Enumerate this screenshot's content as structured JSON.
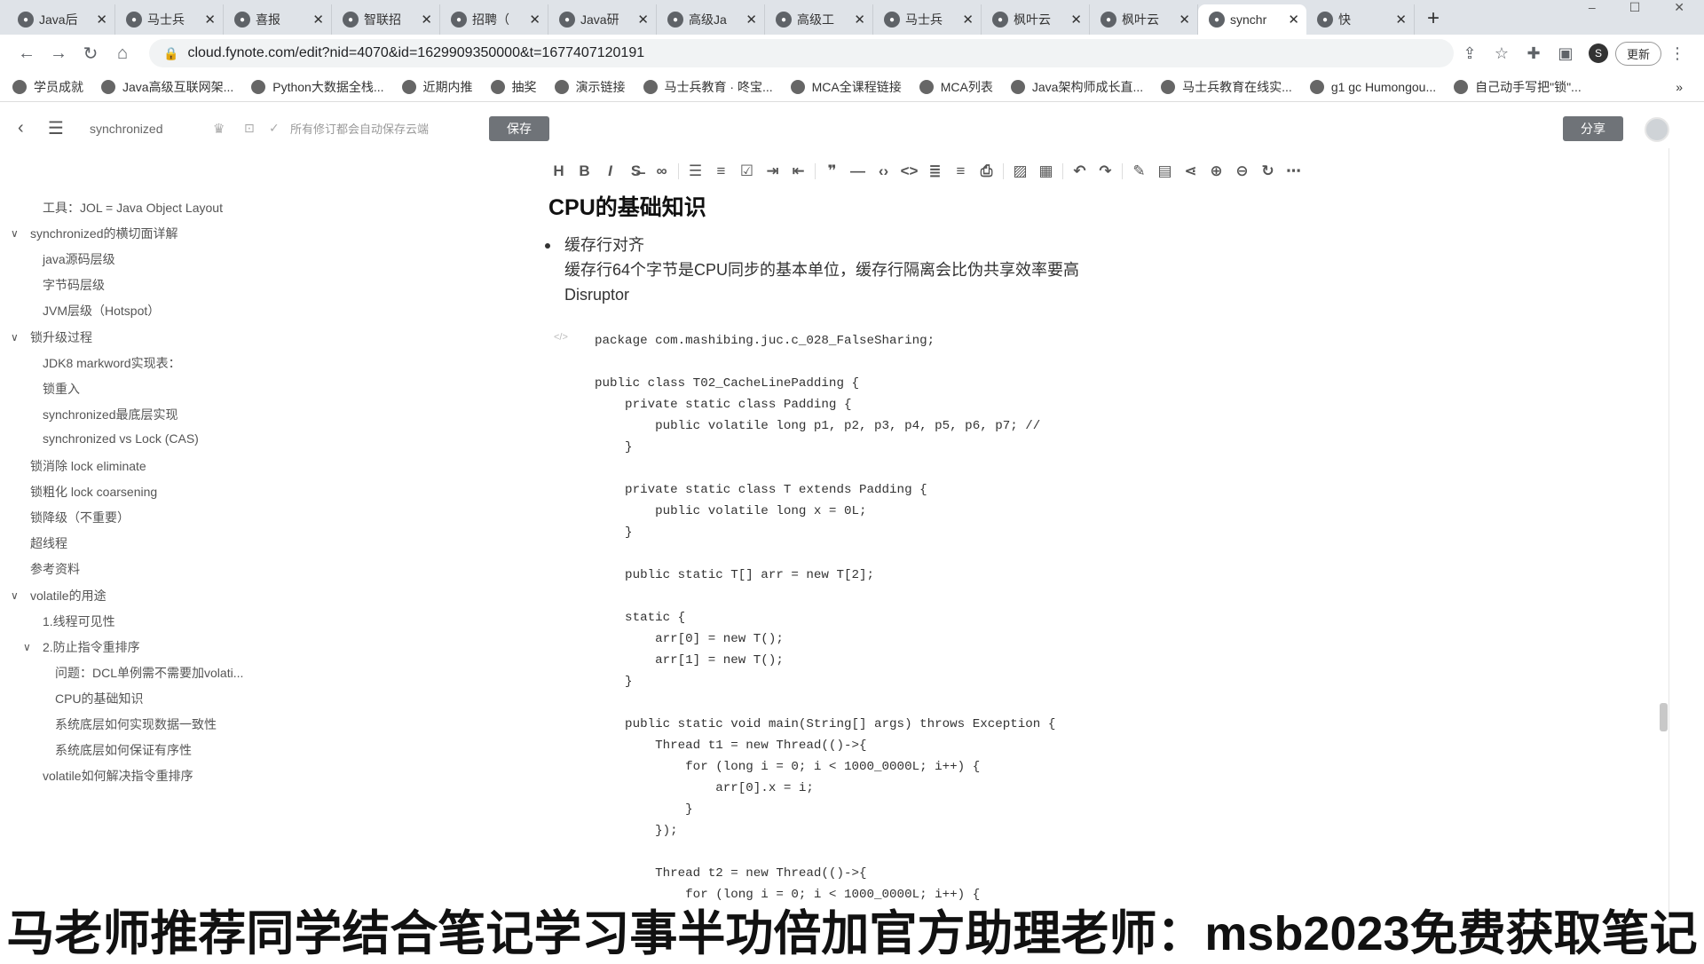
{
  "browser": {
    "tabs": [
      {
        "title": "Java后",
        "icon": "edge-icon"
      },
      {
        "title": "马士兵",
        "icon": "globe-icon"
      },
      {
        "title": "喜报",
        "icon": "flower-icon"
      },
      {
        "title": "智联招",
        "icon": "page-icon"
      },
      {
        "title": "招聘（",
        "icon": "page-icon"
      },
      {
        "title": "Java研",
        "icon": "page-icon"
      },
      {
        "title": "高级Ja",
        "icon": "page-icon"
      },
      {
        "title": "高级工",
        "icon": "page-icon"
      },
      {
        "title": "马士兵",
        "icon": "globe-icon"
      },
      {
        "title": "枫叶云",
        "icon": "leaf-icon"
      },
      {
        "title": "枫叶云",
        "icon": "leaf-icon"
      },
      {
        "title": "synchr",
        "icon": "leaf-icon",
        "active": true
      },
      {
        "title": "快",
        "icon": "globe-icon"
      }
    ],
    "new_tab": "+",
    "url": "cloud.fynote.com/edit?nid=4070&id=1629909350000&t=1677407120191",
    "profile_initial": "S",
    "update_label": "更新",
    "bookmarks": [
      "学员成就",
      "Java高级互联网架...",
      "Python大数据全栈...",
      "近期内推",
      "抽奖",
      "演示链接",
      "马士兵教育 · 咚宝...",
      "MCA全课程链接",
      "MCA列表",
      "Java架构师成长直...",
      "马士兵教育在线实...",
      "g1 gc Humongou...",
      "自己动手写把\"锁\"..."
    ],
    "bookmarks_more": "»"
  },
  "app": {
    "doc_title": "synchronized",
    "autosave_text": "所有修订都会自动保存云端",
    "save_label": "保存",
    "share_label": "分享"
  },
  "sidebar": {
    "items": [
      {
        "label": "工具：JOL = Java Object Layout",
        "level": 1
      },
      {
        "label": "synchronized的横切面详解",
        "level": 0,
        "expanded": true
      },
      {
        "label": "java源码层级",
        "level": 1
      },
      {
        "label": "字节码层级",
        "level": 1
      },
      {
        "label": "JVM层级（Hotspot）",
        "level": 1
      },
      {
        "label": "锁升级过程",
        "level": 0,
        "expanded": true
      },
      {
        "label": "JDK8 markword实现表：",
        "level": 1
      },
      {
        "label": "锁重入",
        "level": 1
      },
      {
        "label": "synchronized最底层实现",
        "level": 1
      },
      {
        "label": "synchronized vs Lock (CAS)",
        "level": 1
      },
      {
        "label": "锁消除 lock eliminate",
        "level": 0
      },
      {
        "label": "锁粗化 lock coarsening",
        "level": 0
      },
      {
        "label": "锁降级（不重要）",
        "level": 0
      },
      {
        "label": "超线程",
        "level": 0
      },
      {
        "label": "参考资料",
        "level": 0
      },
      {
        "label": "volatile的用途",
        "level": 0,
        "expanded": true
      },
      {
        "label": "1.线程可见性",
        "level": 1
      },
      {
        "label": "2.防止指令重排序",
        "level": 1,
        "expanded": true
      },
      {
        "label": "问题：DCL单例需不需要加volati...",
        "level": 2
      },
      {
        "label": "CPU的基础知识",
        "level": 2
      },
      {
        "label": "系统底层如何实现数据一致性",
        "level": 2
      },
      {
        "label": "系统底层如何保证有序性",
        "level": 2
      },
      {
        "label": "volatile如何解决指令重排序",
        "level": 1
      }
    ]
  },
  "editor": {
    "heading_marker": "H1",
    "heading": "CPU的基础知识",
    "bullet_title": "缓存行对齐",
    "bullet_line2": "缓存行64个字节是CPU同步的基本单位，缓存行隔离会比伪共享效率要高",
    "bullet_line3": "Disruptor",
    "code_marker": "</>",
    "code_lines": [
      "package com.mashibing.juc.c_028_FalseSharing;",
      "",
      "public class T02_CacheLinePadding {",
      "    private static class Padding {",
      "        public volatile long p1, p2, p3, p4, p5, p6, p7; //",
      "    }",
      "",
      "    private static class T extends Padding {",
      "        public volatile long x = 0L;",
      "    }",
      "",
      "    public static T[] arr = new T[2];",
      "",
      "    static {",
      "        arr[0] = new T();",
      "        arr[1] = new T();",
      "    }",
      "",
      "    public static void main(String[] args) throws Exception {",
      "        Thread t1 = new Thread(()->{",
      "            for (long i = 0; i < 1000_0000L; i++) {",
      "                arr[0].x = i;",
      "            }",
      "        });",
      "",
      "        Thread t2 = new Thread(()->{",
      "            for (long i = 0; i < 1000_0000L; i++) {"
    ]
  },
  "toolbar_icons": [
    "heading-icon",
    "bold-icon",
    "italic-icon",
    "strikethrough-icon",
    "link-icon",
    "sep",
    "bullet-list-icon",
    "numbered-list-icon",
    "checklist-icon",
    "indent-icon",
    "outdent-icon",
    "sep",
    "quote-icon",
    "horizontal-rule-icon",
    "inline-code-icon",
    "code-block-icon",
    "align-icon",
    "text-format-icon",
    "print-icon",
    "sep",
    "image-icon",
    "table-icon",
    "sep",
    "undo-icon",
    "redo-icon",
    "sep",
    "pen-icon",
    "note-icon",
    "share-node-icon",
    "zoom-in-icon",
    "zoom-out-icon",
    "refresh-icon",
    "more-icon"
  ],
  "banner_text": "马老师推荐同学结合笔记学习事半功倍加官方助理老师：msb2023免费获取笔记"
}
